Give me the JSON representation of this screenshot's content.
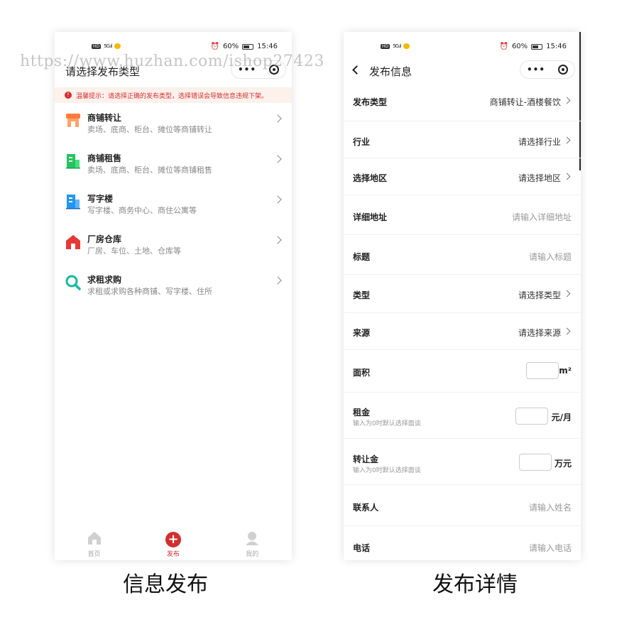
{
  "status_bar": {
    "hd": "HD",
    "signal": "5G.ıl",
    "battery": "60%",
    "time": "15:46"
  },
  "left": {
    "title": "请选择发布类型",
    "notice": "温馨提示：请选择正确的发布类型，选择错误会导致信息违规下架。",
    "categories": [
      {
        "title": "商铺转让",
        "desc": "卖场、底商、柜台、摊位等商铺转让",
        "icon": "shop-icon"
      },
      {
        "title": "商铺租售",
        "desc": "卖场、底商、柜台、摊位等商铺租售",
        "icon": "building-green-icon"
      },
      {
        "title": "写字楼",
        "desc": "写字楼、商务中心、商住公寓等",
        "icon": "office-building-icon"
      },
      {
        "title": "厂房仓库",
        "desc": "厂房、车位、土地、仓库等",
        "icon": "warehouse-icon"
      },
      {
        "title": "求租求购",
        "desc": "求租或求购各种商铺、写字楼、住所",
        "icon": "search-icon"
      }
    ],
    "tabs": [
      {
        "label": "首页"
      },
      {
        "label": "发布"
      },
      {
        "label": "我的"
      }
    ]
  },
  "right": {
    "title": "发布信息",
    "rows": {
      "type": {
        "label": "发布类型",
        "value": "商铺转让-酒楼餐饮"
      },
      "industry": {
        "label": "行业",
        "value": "请选择行业"
      },
      "region": {
        "label": "选择地区",
        "value": "请选择地区"
      },
      "address": {
        "label": "详细地址",
        "placeholder": "请输入详细地址"
      },
      "heading": {
        "label": "标题",
        "placeholder": "请输入标题"
      },
      "kind": {
        "label": "类型",
        "value": "请选择类型"
      },
      "source": {
        "label": "来源",
        "value": "请选择来源"
      },
      "area": {
        "label": "面积",
        "unit": "m²"
      },
      "rent": {
        "label": "租金",
        "sub": "输入为0时默认选择面谈",
        "unit": "元/月"
      },
      "transfer_fee": {
        "label": "转让金",
        "sub": "输入为0时默认选择面谈",
        "unit": "万元"
      },
      "contact": {
        "label": "联系人",
        "placeholder": "请输入姓名"
      },
      "phone": {
        "label": "电话",
        "placeholder": "请输入电话"
      }
    }
  },
  "captions": {
    "left": "信息发布",
    "right": "发布详情"
  },
  "watermark": "https://www.huzhan.com/ishop27423",
  "colors": {
    "accent": "#d32f2f",
    "shop": "#ff7a3d",
    "green": "#22c55e",
    "blue": "#2196f3",
    "warehouse": "#e53935",
    "search": "#14b8a6"
  }
}
